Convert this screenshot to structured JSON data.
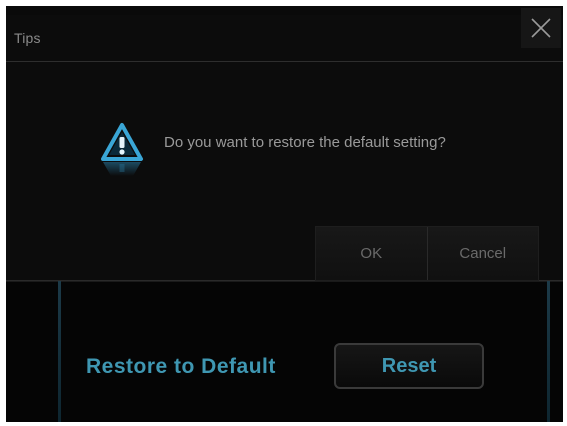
{
  "dialog": {
    "title": "Tips",
    "message": "Do you want to restore the default setting?",
    "ok_label": "OK",
    "cancel_label": "Cancel",
    "icon": "warning-icon",
    "close_icon": "close-icon"
  },
  "panel": {
    "restore_label": "Restore to Default",
    "reset_label": "Reset"
  },
  "colors": {
    "accent": "#3f97b2",
    "background": "#0c0c0c",
    "text_dim": "#9a9a9a"
  }
}
